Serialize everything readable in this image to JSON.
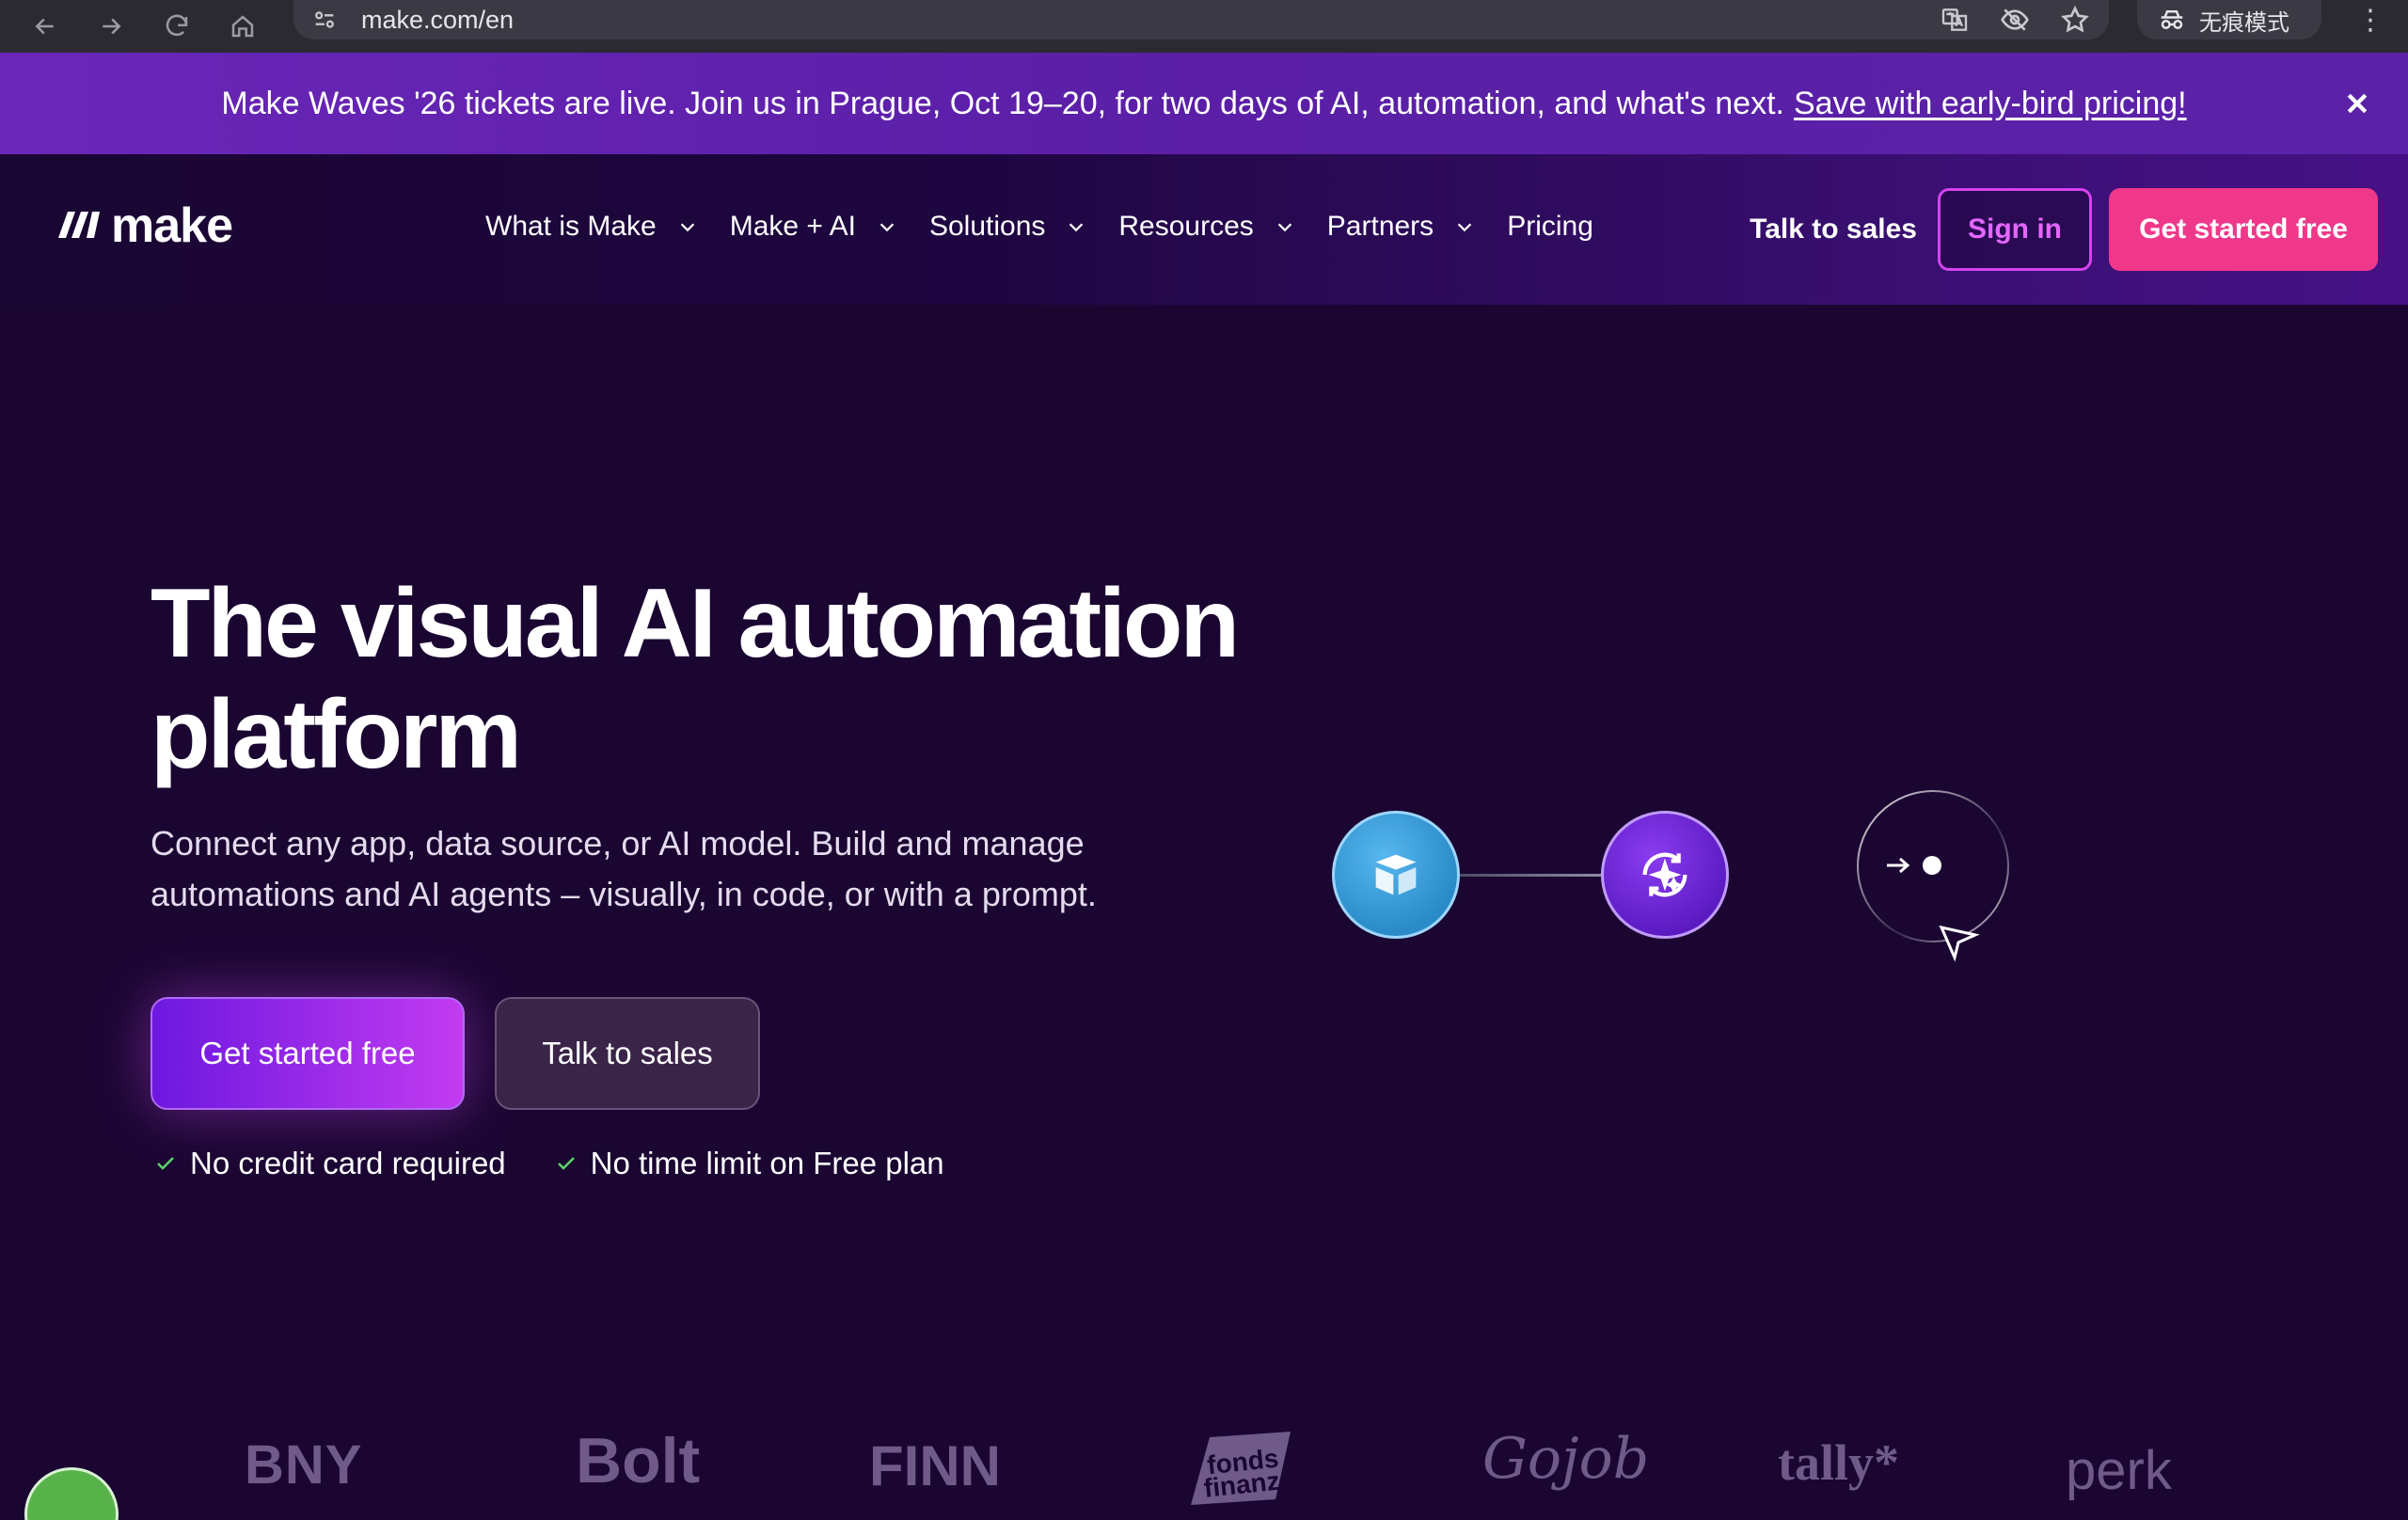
{
  "browser": {
    "url": "make.com/en",
    "incognito_label": "无痕模式"
  },
  "banner": {
    "text": "Make Waves '26 tickets are live. Join us in Prague, Oct 19–20, for two days of AI, automation, and what's next.",
    "link_text": "Save with early-bird pricing!"
  },
  "nav": {
    "logo_text": "make",
    "items": [
      {
        "label": "What is Make",
        "dropdown": true
      },
      {
        "label": "Make + AI",
        "dropdown": true
      },
      {
        "label": "Solutions",
        "dropdown": true
      },
      {
        "label": "Resources",
        "dropdown": true
      },
      {
        "label": "Partners",
        "dropdown": true
      },
      {
        "label": "Pricing",
        "dropdown": false
      }
    ],
    "talk_to_sales": "Talk to sales",
    "sign_in": "Sign in",
    "get_started": "Get started free"
  },
  "hero": {
    "title": "The visual AI automation platform",
    "subtitle": "Connect any app, data source, or AI model. Build and manage automations and AI agents – visually, in code, or with a prompt.",
    "primary_cta": "Get started free",
    "secondary_cta": "Talk to sales",
    "checks": [
      "No credit card required",
      "No time limit on Free plan"
    ]
  },
  "logos": [
    "BNY",
    "Bolt",
    "FINN",
    "fonds finanz",
    "Gojob",
    "tally*",
    "perk"
  ],
  "colors": {
    "brand_pink": "#f0388a",
    "brand_purple": "#6d18e0",
    "banner_purple": "#5a1fa6",
    "background": "#1b0632"
  }
}
